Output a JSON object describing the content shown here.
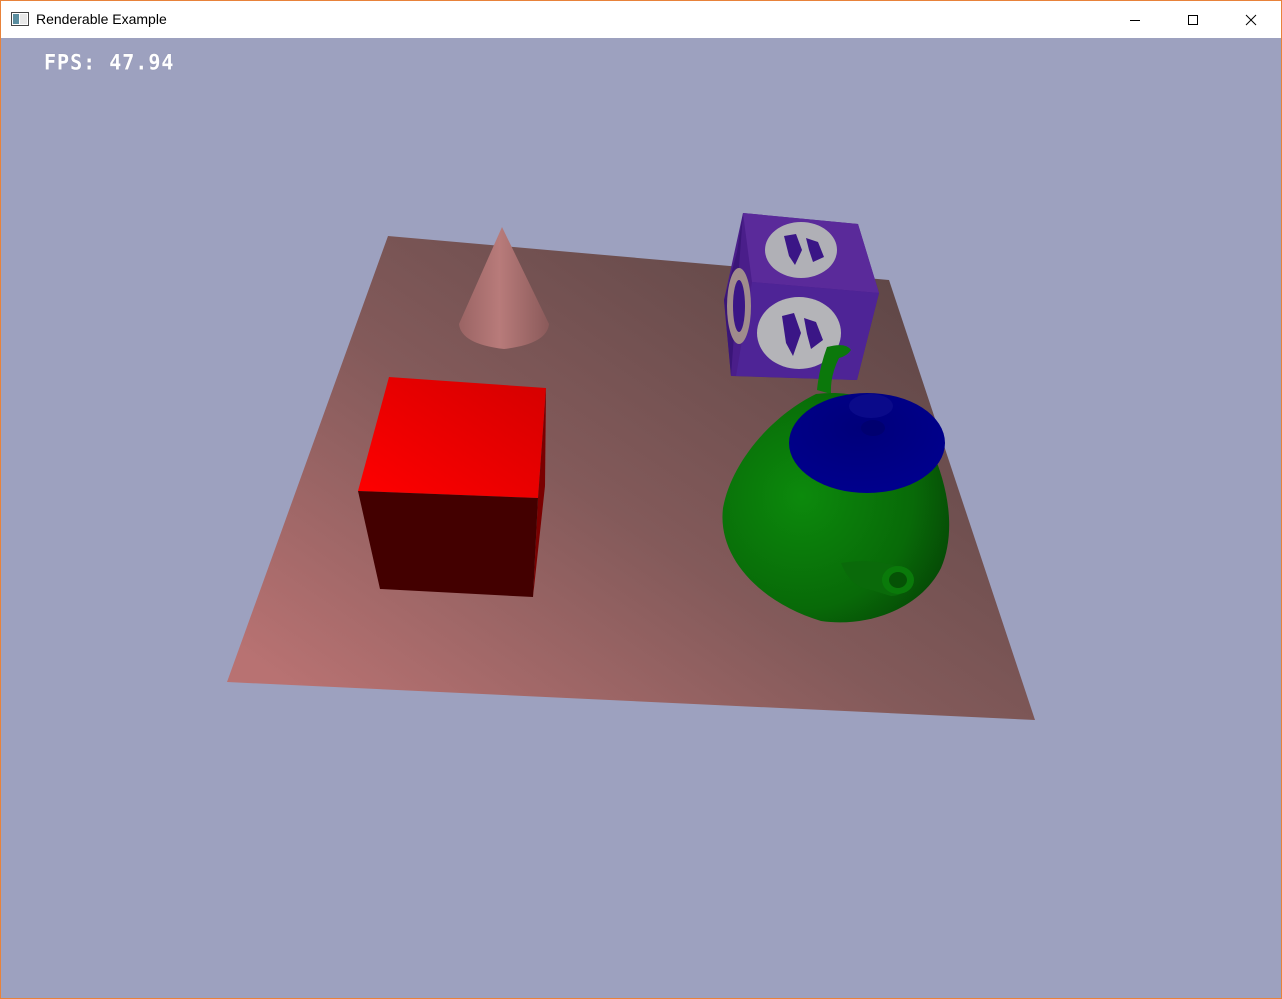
{
  "window": {
    "title": "Renderable Example",
    "border_color": "#e8823a",
    "controls": {
      "minimize_icon": "minimize-icon",
      "maximize_icon": "maximize-icon",
      "close_icon": "close-icon"
    }
  },
  "hud": {
    "fps_text": "FPS: 47.94"
  },
  "scene": {
    "background_color": "#9da1bf",
    "objects": [
      {
        "name": "ground-plane",
        "color": "#8a6060"
      },
      {
        "name": "cone",
        "color": "#b87a78"
      },
      {
        "name": "red-cube",
        "color": "#ff0000"
      },
      {
        "name": "textured-crate",
        "color": "#5a2a9a"
      },
      {
        "name": "teapot",
        "color": "#0a8a0a",
        "lid_color": "#0a0a9a"
      }
    ]
  }
}
